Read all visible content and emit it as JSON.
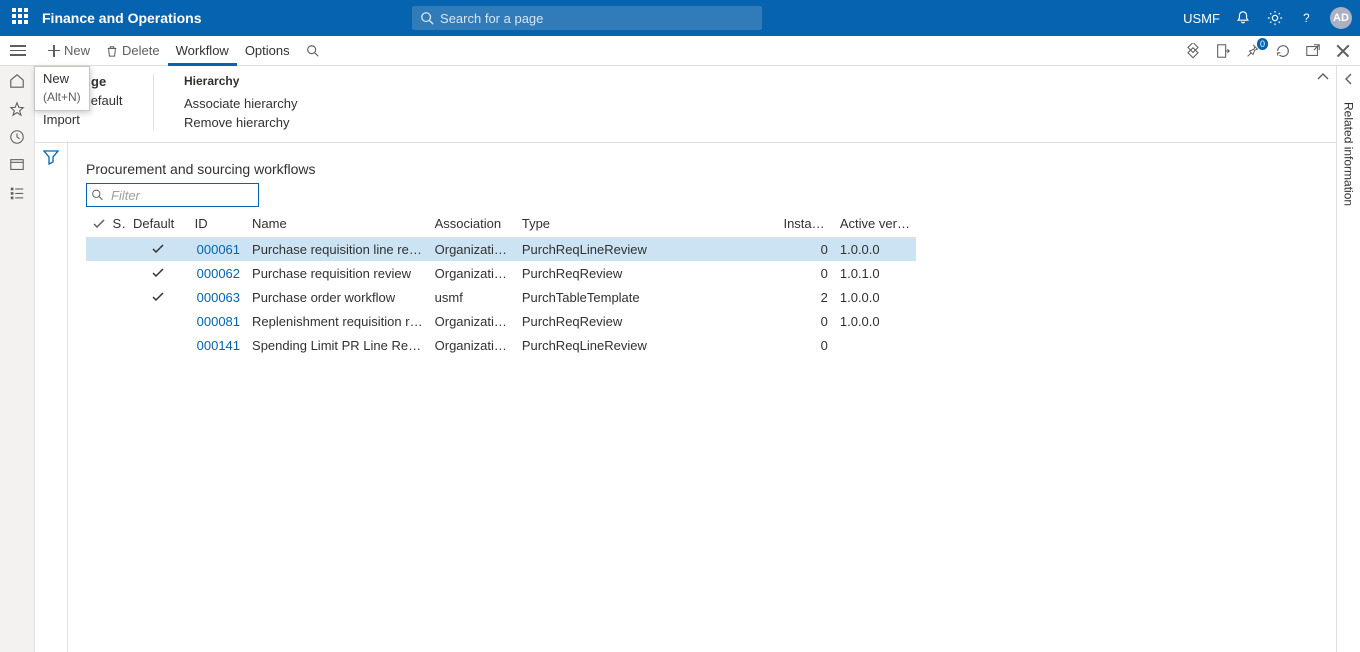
{
  "topbar": {
    "app_title": "Finance and Operations",
    "search_placeholder": "Search for a page",
    "company": "USMF",
    "avatar_initials": "AD"
  },
  "actionbar": {
    "new_label": "New",
    "delete_label": "Delete",
    "workflow_label": "Workflow",
    "options_label": "Options",
    "attach_badge": "0"
  },
  "tooltip_new": {
    "title": "New",
    "shortcut": "(Alt+N)"
  },
  "ribbon": {
    "manage_header": "Manage",
    "manage_items": [
      "Set as default",
      "Import"
    ],
    "manage_trailing": "ge",
    "hierarchy_header": "Hierarchy",
    "hierarchy_items": [
      "Associate hierarchy",
      "Remove hierarchy"
    ]
  },
  "page": {
    "title": "Procurement and sourcing workflows",
    "filter_placeholder": "Filter"
  },
  "grid": {
    "headers": {
      "s": "S...",
      "default": "Default",
      "id": "ID",
      "name": "Name",
      "association": "Association",
      "type": "Type",
      "instances": "Instances",
      "active_version": "Active version"
    },
    "rows": [
      {
        "selected": true,
        "default_checked": true,
        "id": "000061",
        "name": "Purchase requisition line review",
        "association": "Organizatio...",
        "type": "PurchReqLineReview",
        "instances": "0",
        "active_version": "1.0.0.0"
      },
      {
        "selected": false,
        "default_checked": true,
        "id": "000062",
        "name": "Purchase requisition review",
        "association": "Organizatio...",
        "type": "PurchReqReview",
        "instances": "0",
        "active_version": "1.0.1.0"
      },
      {
        "selected": false,
        "default_checked": true,
        "id": "000063",
        "name": "Purchase order workflow",
        "association": "usmf",
        "type": "PurchTableTemplate",
        "instances": "2",
        "active_version": "1.0.0.0"
      },
      {
        "selected": false,
        "default_checked": false,
        "id": "000081",
        "name": "Replenishment requisition rev...",
        "association": "Organizatio...",
        "type": "PurchReqReview",
        "instances": "0",
        "active_version": "1.0.0.0"
      },
      {
        "selected": false,
        "default_checked": false,
        "id": "000141",
        "name": "Spending Limit PR Line Review",
        "association": "Organizatio...",
        "type": "PurchReqLineReview",
        "instances": "0",
        "active_version": ""
      }
    ]
  },
  "rightrail": {
    "label": "Related information"
  }
}
